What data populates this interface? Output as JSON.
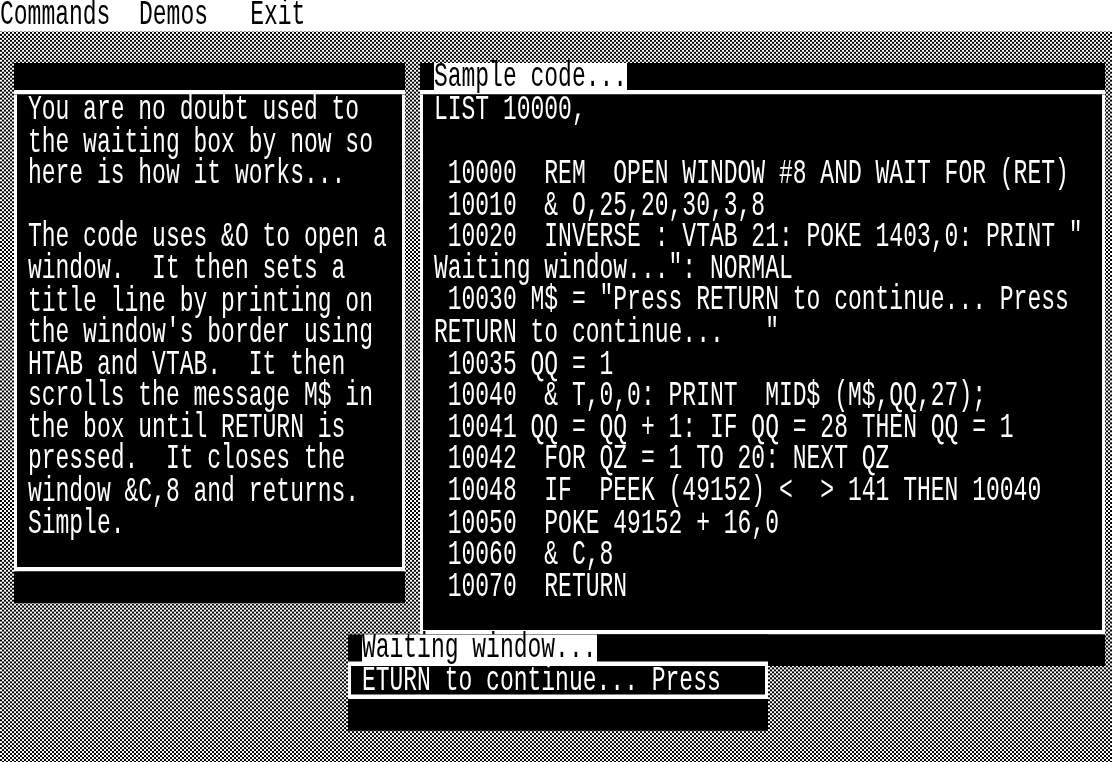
{
  "menu_bar": {
    "items": [
      {
        "label": "Commands"
      },
      {
        "label": "Demos"
      },
      {
        "label": "Exit"
      }
    ]
  },
  "info_window": {
    "paragraphs": [
      [
        "You are no doubt used to",
        "the waiting box by now so",
        "here is how it works..."
      ],
      [
        "The code uses &O to open a",
        "window.  It then sets a",
        "title line by printing on",
        "the window's border using",
        "HTAB and VTAB.  It then",
        "scrolls the message M$ in",
        "the box until RETURN is",
        "pressed.  It closes the",
        "window &C,8 and returns.",
        "Simple."
      ]
    ]
  },
  "code_window": {
    "title": "Sample code...",
    "command": "LIST 10000,",
    "listing": [
      " 10000  REM  OPEN WINDOW #8 AND WAIT FOR (RET)",
      " 10010  & O,25,20,30,3,8",
      " 10020  INVERSE : VTAB 21: POKE 1403,0: PRINT \"",
      "Waiting window...\": NORMAL",
      " 10030 M$ = \"Press RETURN to continue... Press",
      "RETURN to continue...   \"",
      " 10035 QQ = 1",
      " 10040  & T,0,0: PRINT  MID$ (M$,QQ,27);",
      " 10041 QQ = QQ + 1: IF QQ = 28 THEN QQ = 1",
      " 10042  FOR QZ = 1 TO 20: NEXT QZ",
      " 10048  IF  PEEK (49152) <  > 141 THEN 10040",
      " 10050  POKE 49152 + 16,0",
      " 10060  & C,8",
      " 10070  RETURN"
    ]
  },
  "waiting_window": {
    "title": "Waiting window...",
    "message": "ETURN to continue... Press"
  }
}
